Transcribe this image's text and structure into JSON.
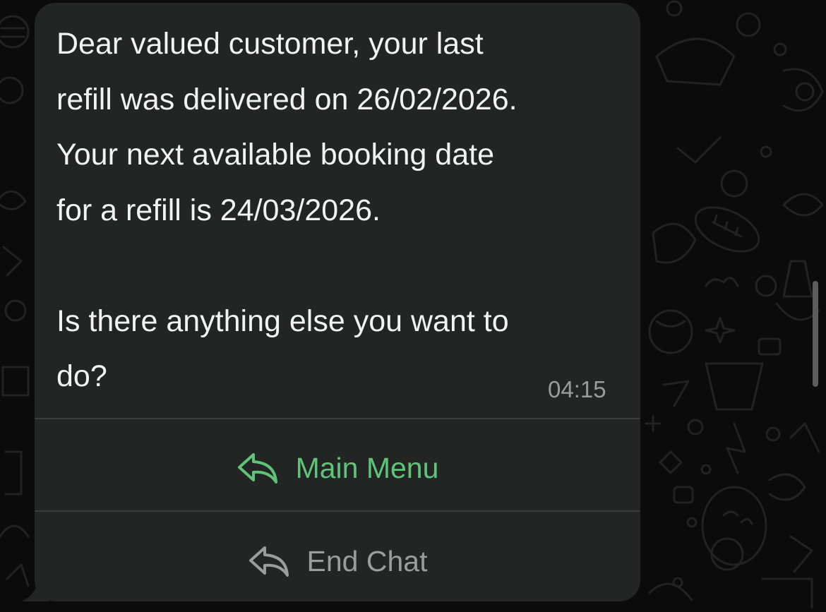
{
  "message": {
    "text": "Dear valued customer, your last\nrefill was delivered on 26/02/2026.\nYour next available booking date\nfor a refill is 24/03/2026.\n\nIs there anything else you want to\ndo?",
    "time": "04:15"
  },
  "buttons": [
    {
      "label": "Main Menu",
      "icon": "reply-arrow-icon",
      "color": "#5fc37a"
    },
    {
      "label": "End Chat",
      "icon": "reply-arrow-icon",
      "color": "#9b9c9c"
    }
  ],
  "colors": {
    "background": "#0b0b0b",
    "bubble": "#232424",
    "message_text": "#f2f2f2",
    "timestamp": "#9a9b9b",
    "divider": "#3a3b3b"
  }
}
